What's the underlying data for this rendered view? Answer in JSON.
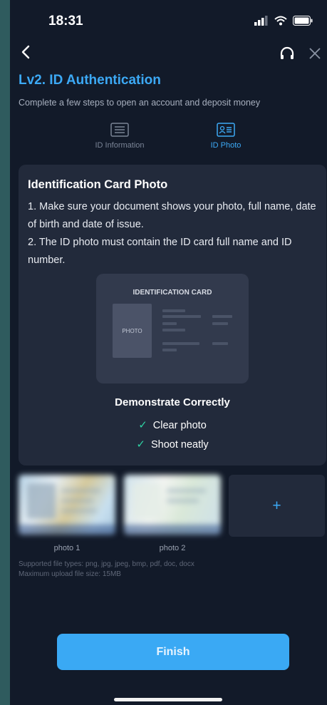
{
  "status_bar": {
    "time": "18:31"
  },
  "header": {
    "back_icon": "chevron-left-icon",
    "support_icon": "headset-icon",
    "close_icon": "close-icon"
  },
  "page": {
    "title": "Lv2. ID Authentication",
    "subtitle": "Complete a few steps to open an account and deposit money"
  },
  "tabs": [
    {
      "label": "ID Information",
      "icon": "document-list-icon",
      "active": false
    },
    {
      "label": "ID Photo",
      "icon": "id-card-icon",
      "active": true
    }
  ],
  "card": {
    "title": "Identification Card Photo",
    "instructions": [
      "1. Make sure your document shows your photo, full name, date of birth and date of issue.",
      "2. The ID photo must contain the ID card full name and ID number."
    ],
    "sample_card_label": "IDENTIFICATION CARD",
    "sample_photo_label": "PHOTO",
    "demonstrate_title": "Demonstrate Correctly",
    "checks": [
      "Clear photo",
      "Shoot neatly"
    ]
  },
  "uploads": {
    "photos": [
      {
        "label": "photo 1"
      },
      {
        "label": "photo 2"
      }
    ],
    "add_label": "+",
    "supported_types": "Supported file types: png, jpg, jpeg, bmp, pdf, doc, docx",
    "max_size": "Maximum upload file size: 15MB"
  },
  "footer": {
    "finish_label": "Finish"
  },
  "colors": {
    "accent": "#3ca9f5",
    "background": "#121a29",
    "card": "#222a3b",
    "check": "#2fd1a3"
  }
}
